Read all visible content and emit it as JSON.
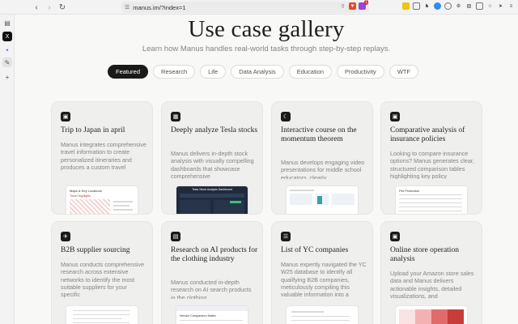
{
  "browser": {
    "url": "manus.im/?index=1",
    "shield_badge": "1"
  },
  "page": {
    "title": "Use case gallery",
    "subtitle": "Learn how Manus handles real-world tasks through step-by-step replays."
  },
  "tabs": [
    {
      "label": "Featured",
      "active": true
    },
    {
      "label": "Research",
      "active": false
    },
    {
      "label": "Life",
      "active": false
    },
    {
      "label": "Data Analysis",
      "active": false
    },
    {
      "label": "Education",
      "active": false
    },
    {
      "label": "Productivity",
      "active": false
    },
    {
      "label": "WTF",
      "active": false
    }
  ],
  "cards": [
    {
      "icon": "briefcase-icon",
      "title": "Trip to Japan in april",
      "description": "Manus integrates comprehensive travel information to create personalized itineraries and produces a custom travel",
      "thumbnail_title": "Maps & Key Locations",
      "thumbnail_subtitle": "Travel Highlights"
    },
    {
      "icon": "chart-icon",
      "title": "Deeply analyze Tesla stocks",
      "description": "Manus delivers in-depth stock analysis with visually compelling dashboards that showcase comprehensive",
      "thumbnail_title": "Tesla Stock Analysis Dashboard"
    },
    {
      "icon": "book-icon",
      "title": "Interactive course on the momentum theorem",
      "description": "Manus develops engaging video presentations for middle school educators, clearly",
      "thumbnail_title": ""
    },
    {
      "icon": "briefcase-icon",
      "title": "Comparative analysis of insurance policies",
      "description": "Looking to compare insurance options? Manus generates clear, structured comparison tables highlighting key policy",
      "thumbnail_title": "Pet Protection"
    },
    {
      "icon": "rocket-icon",
      "title": "B2B supplier sourcing",
      "description": "Manus conducts comprehensive research across extensive networks to identify the most suitable suppliers for your specific",
      "thumbnail_title": ""
    },
    {
      "icon": "document-icon",
      "title": "Research on AI products for the clothing industry",
      "description": "Manus conducted in-depth research on AI search products in the clothing",
      "thumbnail_title": "Vendor Comparison Matrix"
    },
    {
      "icon": "list-icon",
      "title": "List of YC companies",
      "description": "Manus expertly navigated the YC W25 database to identify all qualifying B2B companies, meticulously compiling this valuable information into a",
      "thumbnail_title": ""
    },
    {
      "icon": "briefcase-icon",
      "title": "Online store operation analysis",
      "description": "Upload your Amazon store sales data and Manus delivers actionable insights, detailed visualizations, and",
      "thumbnail_title": ""
    }
  ]
}
